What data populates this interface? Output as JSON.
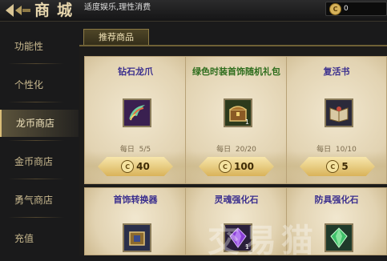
{
  "header": {
    "title": "商城",
    "slogan": "适度娱乐,理性消费",
    "currency": {
      "icon": "dragon-coin-icon",
      "amount": "0"
    }
  },
  "sidebar": {
    "items": [
      {
        "label": "功能性",
        "active": false
      },
      {
        "label": "个性化",
        "active": false
      },
      {
        "label": "龙币商店",
        "active": true
      },
      {
        "label": "金币商店",
        "active": false
      },
      {
        "label": "勇气商店",
        "active": false
      },
      {
        "label": "充值",
        "active": false
      }
    ]
  },
  "tabs": [
    {
      "label": "推荐商品",
      "active": true
    }
  ],
  "products": [
    {
      "name": "钻石龙爪",
      "name_color": "#3b2f8e",
      "icon": "claw-icon",
      "limit_label": "每日",
      "limit": "5/5",
      "price": "40"
    },
    {
      "name": "绿色时装首饰随机礼包",
      "name_color": "#2e6d1d",
      "icon": "chest-icon",
      "qty": "1",
      "limit_label": "每日",
      "limit": "20/20",
      "price": "100"
    },
    {
      "name": "复活书",
      "name_color": "#3b2f8e",
      "icon": "book-icon",
      "limit_label": "每日",
      "limit": "10/10",
      "price": "5"
    },
    {
      "name": "首饰转换器",
      "name_color": "#3b2f8e",
      "icon": "box-icon"
    },
    {
      "name": "灵魂强化石",
      "name_color": "#3b2f8e",
      "icon": "purple-gem-icon",
      "qty": "1"
    },
    {
      "name": "防具强化石",
      "name_color": "#3b2f8e",
      "icon": "green-gem-icon"
    }
  ],
  "watermark": "交易猫"
}
